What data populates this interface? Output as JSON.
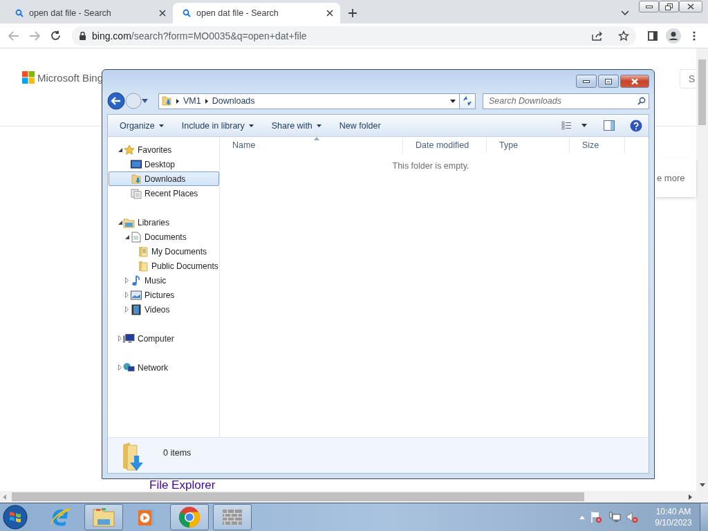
{
  "browser": {
    "tabs": [
      {
        "title": "open dat file - Search",
        "selected": false
      },
      {
        "title": "open dat file - Search",
        "selected": true
      }
    ],
    "url_host": "bing.com",
    "url_path": "/search?form=MO0035&q=open+dat+file"
  },
  "page": {
    "logo": "Microsoft Bing",
    "search_button": "S",
    "side_link": "e more",
    "link": "File Explorer"
  },
  "explorer": {
    "breadcrumb": [
      "VM1",
      "Downloads"
    ],
    "search": {
      "placeholder": "Search Downloads"
    },
    "toolbar": [
      {
        "label": "Organize",
        "dropdown": true
      },
      {
        "label": "Include in library",
        "dropdown": true
      },
      {
        "label": "Share with",
        "dropdown": true
      },
      {
        "label": "New folder",
        "dropdown": false
      }
    ],
    "nav": [
      {
        "label": "Favorites",
        "kind": "star",
        "expanded": true,
        "selected": false,
        "children": [
          {
            "label": "Desktop",
            "kind": "desktop",
            "selected": false
          },
          {
            "label": "Downloads",
            "kind": "downloads",
            "selected": true
          },
          {
            "label": "Recent Places",
            "kind": "recent",
            "selected": false
          }
        ]
      },
      {
        "label": "Libraries",
        "kind": "library",
        "expanded": true,
        "selected": false,
        "children": [
          {
            "label": "Documents",
            "kind": "documents",
            "expanded": true,
            "selected": false,
            "children": [
              {
                "label": "My Documents",
                "kind": "folder-doc",
                "selected": false
              },
              {
                "label": "Public Documents",
                "kind": "folder",
                "selected": false
              }
            ]
          },
          {
            "label": "Music",
            "kind": "music",
            "expanded": false,
            "selected": false
          },
          {
            "label": "Pictures",
            "kind": "pictures",
            "expanded": false,
            "selected": false
          },
          {
            "label": "Videos",
            "kind": "videos",
            "expanded": false,
            "selected": false
          }
        ]
      },
      {
        "label": "Computer",
        "kind": "computer",
        "expanded": false,
        "selected": false
      },
      {
        "label": "Network",
        "kind": "network",
        "expanded": false,
        "selected": false
      }
    ],
    "columns": [
      "Name",
      "Date modified",
      "Type",
      "Size"
    ],
    "empty_message": "This folder is empty.",
    "status": "0 items"
  },
  "taskbar": {
    "apps": [
      {
        "kind": "ie",
        "running": false
      },
      {
        "kind": "explorer",
        "running": true
      },
      {
        "kind": "media",
        "running": false
      },
      {
        "kind": "chrome",
        "running": true
      },
      {
        "kind": "firewall",
        "running": true
      }
    ],
    "time": "10:40 AM",
    "date": "9/10/2023"
  }
}
